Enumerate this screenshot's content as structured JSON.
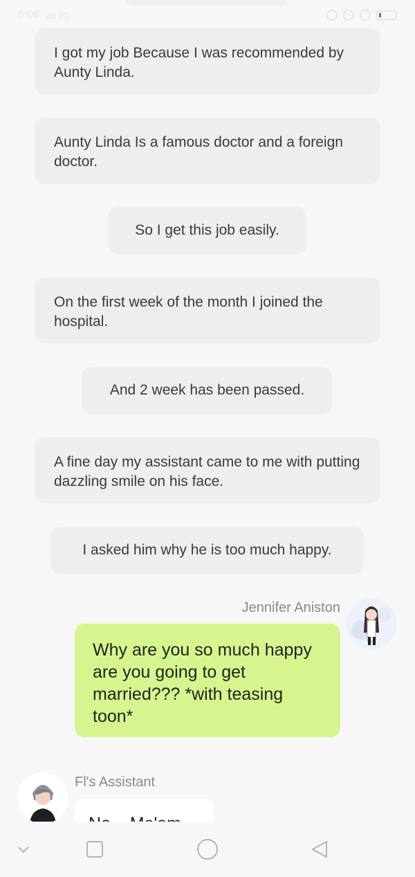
{
  "status_bar": {
    "time": "8:06",
    "network": "all 4G"
  },
  "narration": [
    "I got my job Because I was recommended by Aunty Linda.",
    "Aunty Linda Is a famous doctor and a foreign doctor.",
    "So I get this job easily.",
    "On the first week of the month I joined the hospital.",
    "And 2 week has been passed.",
    "A fine day my assistant came to me with putting dazzling smile on his face.",
    "I asked him why he is too much happy."
  ],
  "messages": [
    {
      "speaker": "Jennifer Aniston",
      "text": "Why are you so much happy are you going to get married??? *with teasing toon*"
    },
    {
      "speaker": "Fl's Assistant",
      "text": "No... Ma'am"
    }
  ],
  "nav": {
    "icons": [
      "chevron-down-icon",
      "square-icon",
      "circle-icon",
      "triangle-back-icon"
    ]
  }
}
